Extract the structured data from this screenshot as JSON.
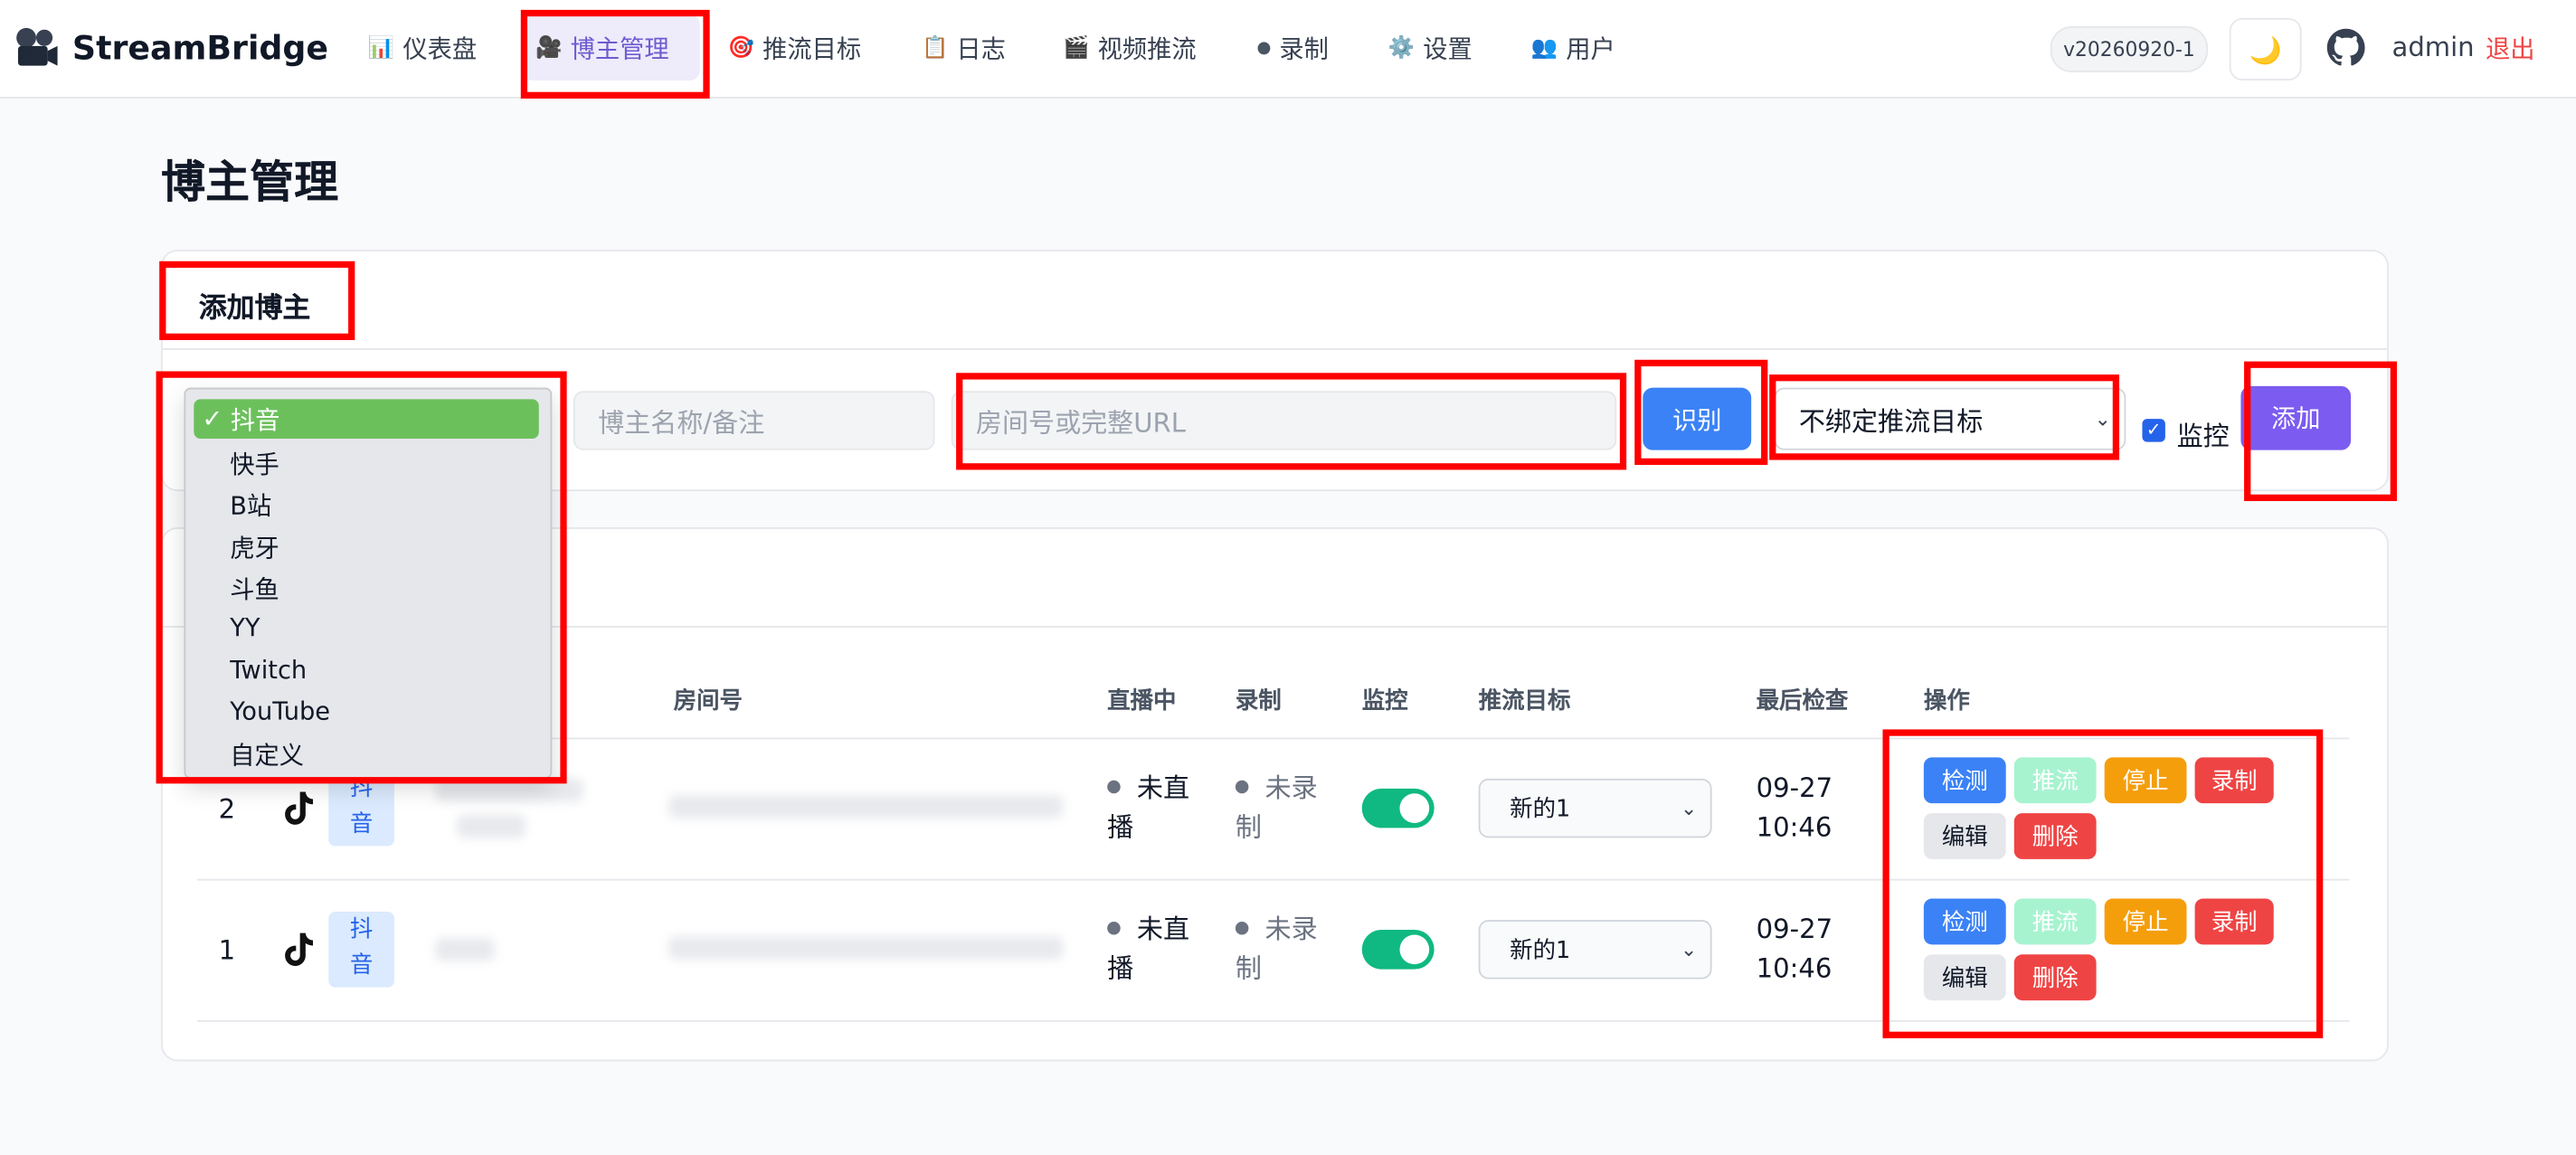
{
  "header": {
    "brand": "StreamBridge",
    "nav": [
      {
        "icon": "📊",
        "label": "仪表盘"
      },
      {
        "icon": "🎥",
        "label": "博主管理"
      },
      {
        "icon": "🎯",
        "label": "推流目标"
      },
      {
        "icon": "📋",
        "label": "日志"
      },
      {
        "icon": "🎬",
        "label": "视频推流"
      },
      {
        "icon": "●",
        "label": "录制"
      },
      {
        "icon": "⚙️",
        "label": "设置"
      },
      {
        "icon": "👥",
        "label": "用户"
      }
    ],
    "version": "v20260920-1",
    "theme_icon": "🌙",
    "user": "admin",
    "logout": "退出"
  },
  "page_title": "博主管理",
  "add_card": {
    "title": "添加博主",
    "name_placeholder": "博主名称/备注",
    "room_placeholder": "房间号或完整URL",
    "identify_button": "识别",
    "target_select": "不绑定推流目标",
    "monitor_label": "监控",
    "add_button": "添加"
  },
  "platform_dropdown": {
    "check": "✓",
    "options": [
      "抖音",
      "快手",
      "B站",
      "虎牙",
      "斗鱼",
      "YY",
      "Twitch",
      "YouTube",
      "自定义"
    ],
    "selected_index": 0
  },
  "table": {
    "headers": {
      "room": "房间号",
      "live": "直播中",
      "record": "录制",
      "monitor": "监控",
      "target": "推流目标",
      "last_check": "最后检查",
      "actions": "操作"
    },
    "rows": [
      {
        "id": "2",
        "platform_line1": "抖",
        "platform_line2": "音",
        "live_line1": "未直",
        "live_line2": "播",
        "rec_line1": "未录",
        "rec_line2": "制",
        "monitor": true,
        "target": "新的1",
        "date": "09-27",
        "time": "10:46"
      },
      {
        "id": "1",
        "platform_line1": "抖",
        "platform_line2": "音",
        "live_line1": "未直",
        "live_line2": "播",
        "rec_line1": "未录",
        "rec_line2": "制",
        "monitor": true,
        "target": "新的1",
        "date": "09-27",
        "time": "10:46"
      }
    ],
    "action_labels": {
      "detect": "检测",
      "push": "推流",
      "stop": "停止",
      "record": "录制",
      "edit": "编辑",
      "delete": "删除"
    }
  },
  "colors": {
    "accent": "#7c5cf0",
    "primary": "#3b82f6",
    "danger": "#ef4444",
    "warning": "#f59e0b",
    "success": "#10b981",
    "highlight": "#ff0000"
  }
}
